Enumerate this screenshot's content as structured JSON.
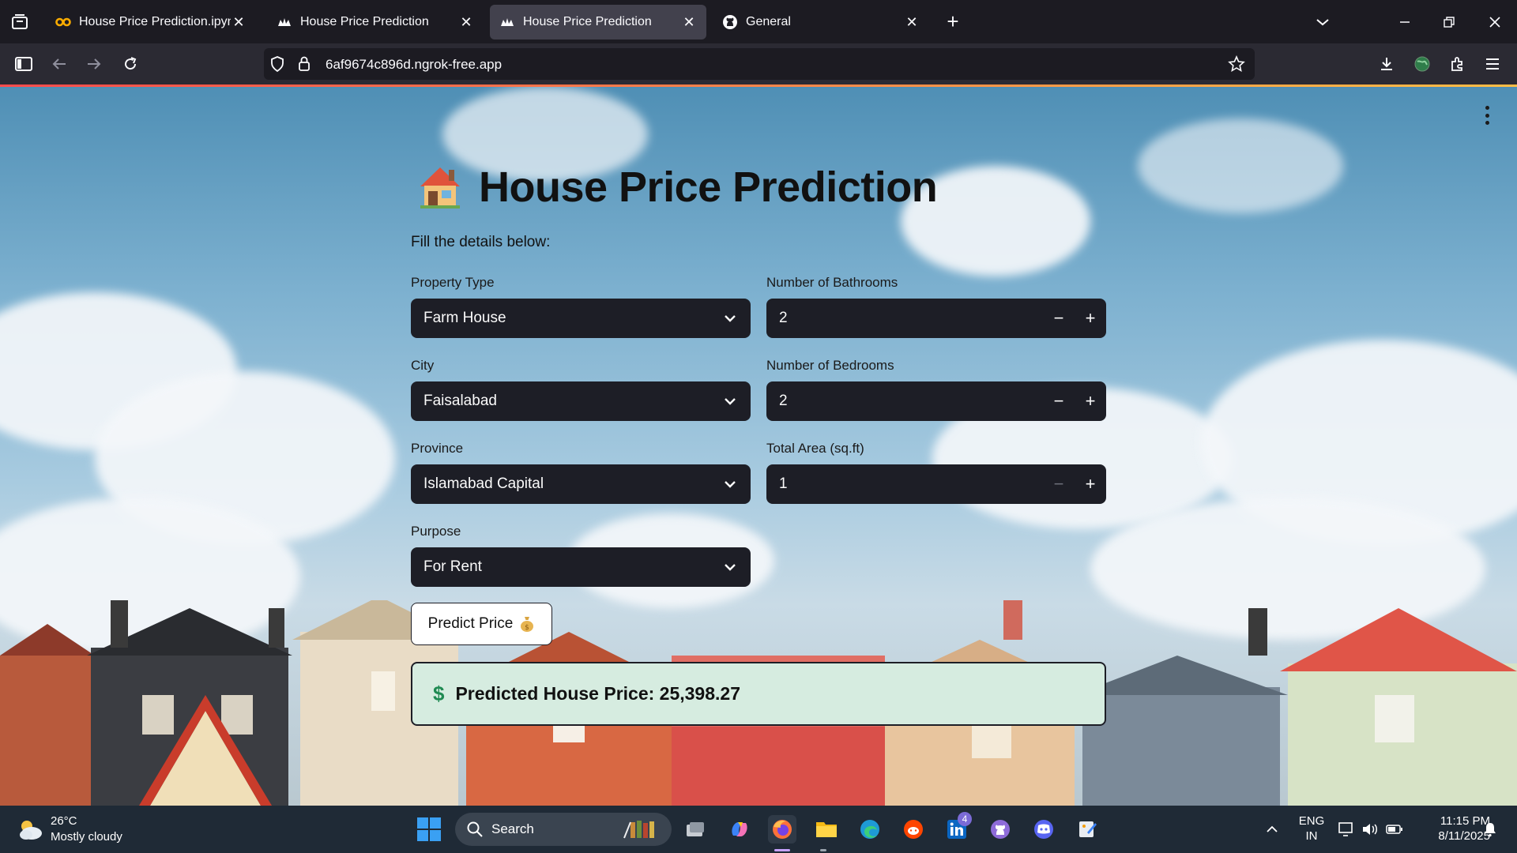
{
  "browser": {
    "tabs": [
      {
        "title": "House Price Prediction.ipynb - C",
        "icon": "colab-icon",
        "active": false
      },
      {
        "title": "House Price Prediction",
        "icon": "streamlit-icon",
        "active": false
      },
      {
        "title": "House Price Prediction",
        "icon": "streamlit-icon",
        "active": true
      },
      {
        "title": "General",
        "icon": "github-icon",
        "active": false
      }
    ],
    "url": "6af9674c896d.ngrok-free.app",
    "accent": "#ff4b4b"
  },
  "app": {
    "title": "House Price Prediction",
    "subtitle": "Fill the details below:",
    "fields": {
      "property_type": {
        "label": "Property Type",
        "value": "Farm House"
      },
      "city": {
        "label": "City",
        "value": "Faisalabad"
      },
      "province": {
        "label": "Province",
        "value": "Islamabad Capital"
      },
      "purpose": {
        "label": "Purpose",
        "value": "For Rent"
      },
      "bathrooms": {
        "label": "Number of Bathrooms",
        "value": "2"
      },
      "bedrooms": {
        "label": "Number of Bedrooms",
        "value": "2"
      },
      "area": {
        "label": "Total Area (sq.ft)",
        "value": "1"
      }
    },
    "predict_button": "Predict Price",
    "result": {
      "icon": "$",
      "text": "Predicted House Price: 25,398.27",
      "bg": "#d6ece0"
    }
  },
  "taskbar": {
    "weather": {
      "temp": "26°C",
      "desc": "Mostly cloudy"
    },
    "search_placeholder": "Search",
    "linkedin_badge": "4",
    "lang_top": "ENG",
    "lang_bottom": "IN",
    "time": "11:15 PM",
    "date": "8/11/2025"
  }
}
